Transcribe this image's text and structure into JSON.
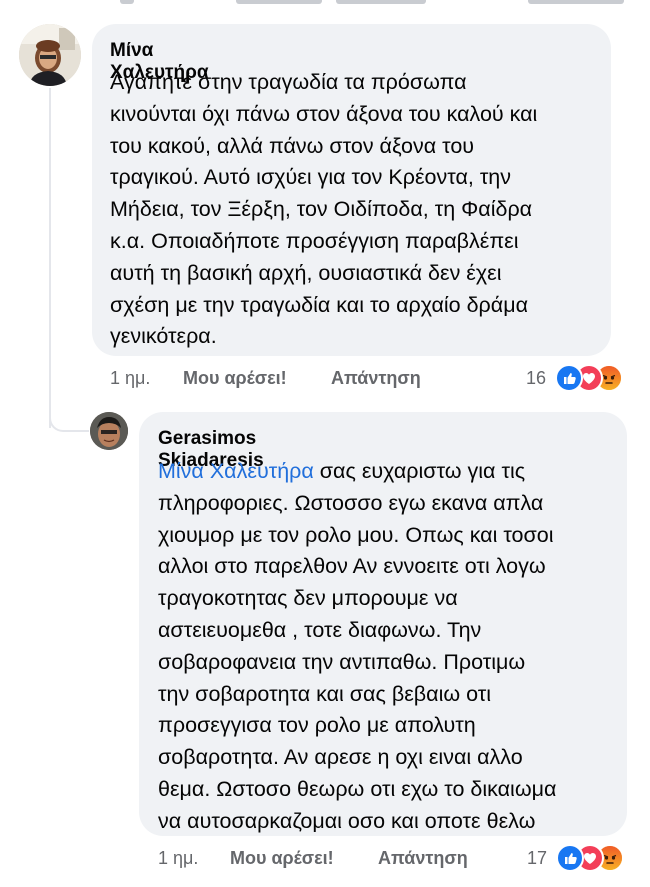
{
  "comments": [
    {
      "author": "Μίνα Χαλευτήρα",
      "lines": [
        "Αγαπητέ στην τραγωδία τα πρόσωπα",
        "κινούνται όχι πάνω στον άξονα του καλού και",
        "του κακού, αλλά πάνω στον άξονα του",
        "τραγικού. Αυτό ισχύει για τον Κρέοντα, την",
        "Μήδεια, τον Ξέρξη, τον Οιδίποδα, τη Φαίδρα",
        "κ.α. Οποιαδήποτε προσέγγιση παραβλέπει",
        "αυτή τη βασική αρχή, ουσιαστικά δεν έχει",
        "σχέση με την τραγωδία και το αρχαίο δράμα",
        "γενικότερα."
      ],
      "time": "1 ημ.",
      "like_label": "Μου αρέσει!",
      "reply_label": "Απάντηση",
      "reaction_count": "16",
      "reactions": [
        "like-icon",
        "love-icon",
        "angry-icon"
      ]
    },
    {
      "author": "Gerasimos Skiadaresis",
      "mention": "Μίνα Χαλευτήρα",
      "first_line_rest": " σας ευχαριστω για τις",
      "lines": [
        "πληροφοριες. Ωστοσσο εγω εκανα απλα",
        "χιουμορ με τον ρολο μου. Οπως και  τοσοι",
        "αλλοι στο παρελθον  Αν εννοειτε οτι λογω",
        "τραγοκοτητας δεν μπορουμε να",
        "αστειευομεθα , τοτε διαφωνω. Την",
        "σοβαροφανεια την αντιπαθω. Προτιμω",
        "την σοβαροτητα και σας βεβαιω οτι",
        "προσεγγισα τον ρολο με απολυτη",
        "σοβαροτητα. Αν αρεσε η οχι ειναι αλλο",
        "θεμα. Ωστοσο θεωρω οτι εχω το δικαιωμα",
        "να αυτοσαρκαζομαι οσο και οποτε θελω"
      ],
      "time": "1 ημ.",
      "like_label": "Μου αρέσει!",
      "reply_label": "Απάντηση",
      "reaction_count": "17",
      "reactions": [
        "like-icon",
        "love-icon",
        "angry-icon"
      ]
    }
  ],
  "colors": {
    "bubble": "#f0f2f5",
    "mention": "#216fdb",
    "meta": "#65676b",
    "like": "#1877f2",
    "love": "#f33e58",
    "angry": "#f7b125"
  }
}
